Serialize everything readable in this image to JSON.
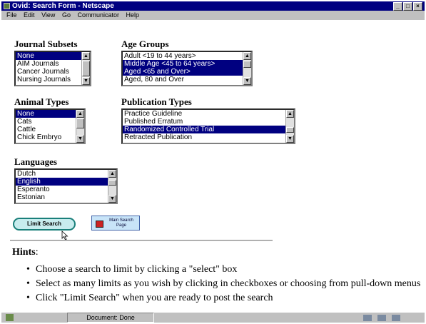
{
  "window": {
    "title": "Ovid: Search Form - Netscape"
  },
  "menu": [
    "File",
    "Edit",
    "View",
    "Go",
    "Communicator",
    "Help"
  ],
  "sections": {
    "journal_subsets": {
      "heading": "Journal Subsets",
      "items": [
        {
          "label": "None",
          "selected": true
        },
        {
          "label": "AIM Journals",
          "selected": false
        },
        {
          "label": "Cancer Journals",
          "selected": false
        },
        {
          "label": "Nursing Journals",
          "selected": false
        }
      ]
    },
    "age_groups": {
      "heading": "Age Groups",
      "items": [
        {
          "label": "Adult <19 to 44 years>",
          "selected": false
        },
        {
          "label": "Middle Age <45 to 64 years>",
          "selected": true
        },
        {
          "label": "Aged <65 and Over>",
          "selected": true
        },
        {
          "label": "Aged, 80 and Over",
          "selected": false
        }
      ]
    },
    "animal_types": {
      "heading": "Animal Types",
      "items": [
        {
          "label": "None",
          "selected": true
        },
        {
          "label": "Cats",
          "selected": false
        },
        {
          "label": "Cattle",
          "selected": false
        },
        {
          "label": "Chick Embryo",
          "selected": false
        }
      ]
    },
    "publication_types": {
      "heading": "Publication Types",
      "items": [
        {
          "label": "Practice Guideline",
          "selected": false
        },
        {
          "label": "Published Erratum",
          "selected": false
        },
        {
          "label": "Randomized Controlled Trial",
          "selected": true
        },
        {
          "label": "Retracted Publication",
          "selected": false
        }
      ]
    },
    "languages": {
      "heading": "Languages",
      "items": [
        {
          "label": "Dutch",
          "selected": false
        },
        {
          "label": "English",
          "selected": true
        },
        {
          "label": "Esperanto",
          "selected": false
        },
        {
          "label": "Estonian",
          "selected": false
        }
      ]
    }
  },
  "buttons": {
    "limit_search": "Limit Search",
    "main_search_page": "Main Search Page"
  },
  "hints": {
    "heading": "Hints",
    "items": [
      "Choose a search to limit by clicking a \"select\" box",
      "Select as many limits as you wish by clicking in checkboxes or choosing from pull-down menus",
      "Click \"Limit Search\" when you are ready to post the search"
    ]
  },
  "status": {
    "text": "Document: Done"
  },
  "colors": {
    "titlebar": "#000080",
    "selection": "#000080",
    "chrome": "#c0c0c0"
  }
}
